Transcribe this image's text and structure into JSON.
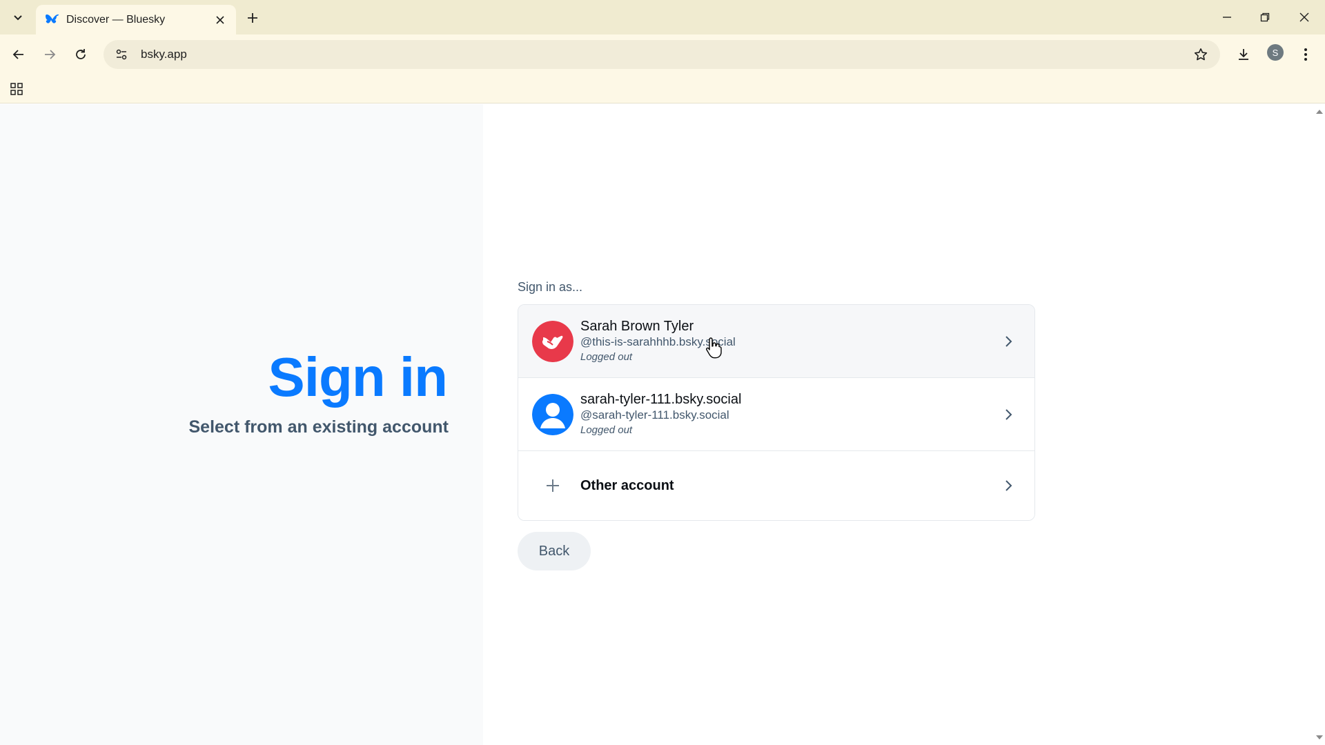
{
  "browser": {
    "tab_title": "Discover — Bluesky",
    "url": "bsky.app",
    "profile_initial": "S"
  },
  "page": {
    "title": "Sign in",
    "subtitle": "Select from an existing account",
    "sign_in_as_label": "Sign in as...",
    "accounts": [
      {
        "name": "Sarah Brown Tyler",
        "handle": "@this-is-sarahhhb.bsky.social",
        "status": "Logged out",
        "avatar_color": "#e8394a"
      },
      {
        "name": "sarah-tyler-111.bsky.social",
        "handle": "@sarah-tyler-111.bsky.social",
        "status": "Logged out",
        "avatar_color": "#0a7aff"
      }
    ],
    "other_account_label": "Other account",
    "back_label": "Back"
  },
  "colors": {
    "accent": "#0a7aff",
    "chrome_bg": "#f0ebd0",
    "toolbar_bg": "#fdf8e6",
    "text_muted": "#42576c"
  },
  "icons": {
    "tab_favicon": "bluesky-butterfly-icon",
    "tab_search": "chevron-down-icon",
    "back": "arrow-left-icon",
    "forward": "arrow-right-icon",
    "reload": "reload-icon",
    "bookmark": "star-icon",
    "download": "download-icon",
    "menu": "kebab-menu-icon",
    "apps": "apps-grid-icon"
  }
}
